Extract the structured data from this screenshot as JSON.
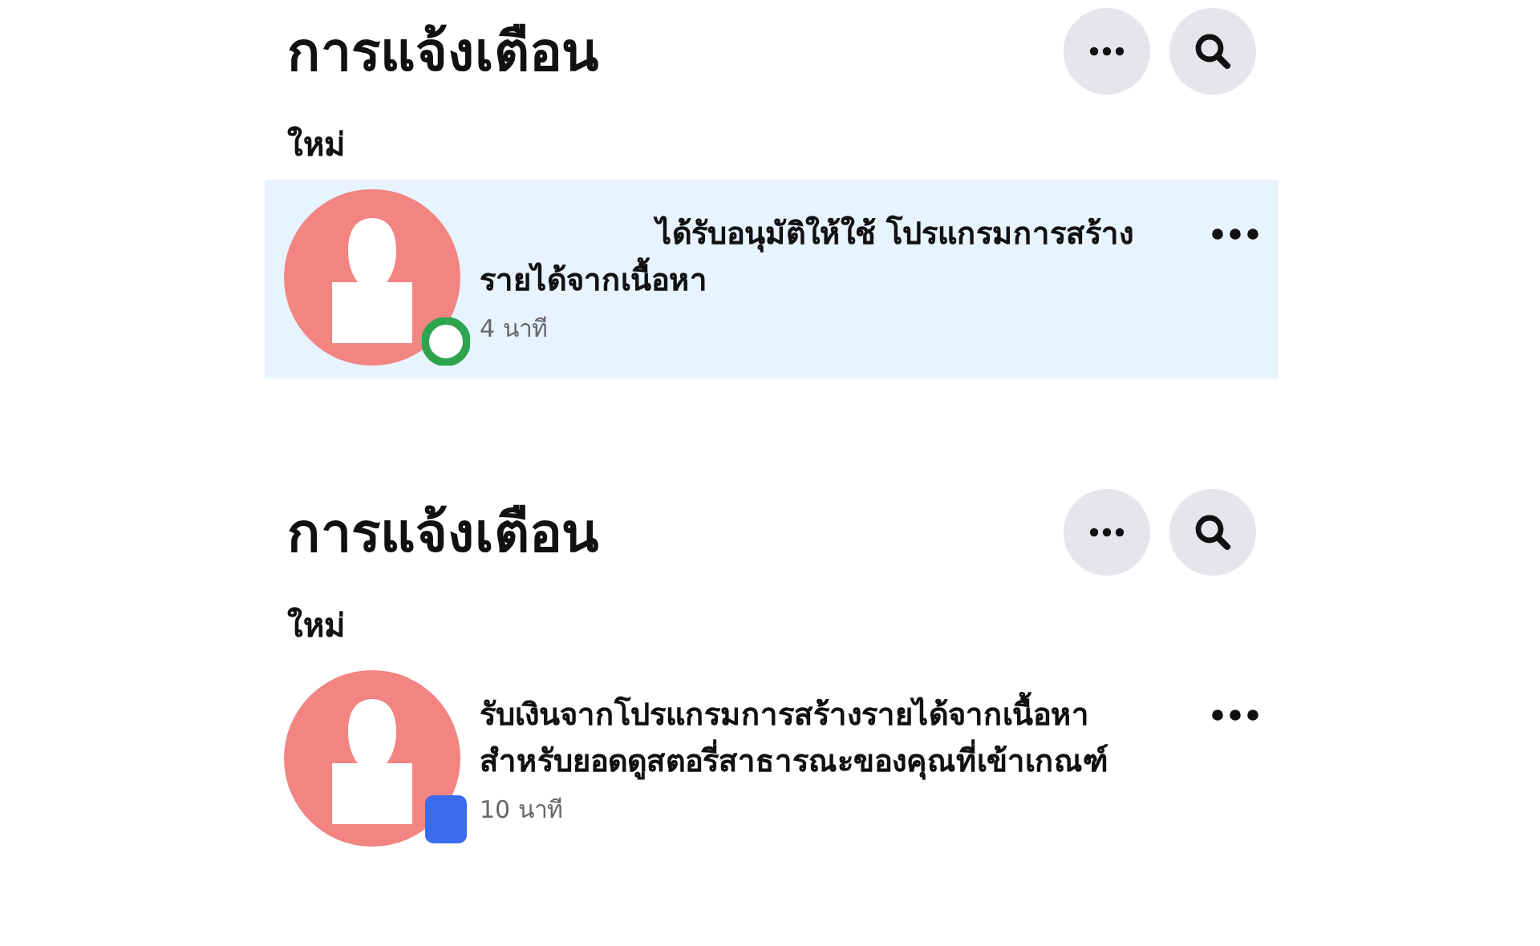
{
  "panels": [
    {
      "title": "การแจ้งเตือน",
      "section": "ใหม่",
      "notifications": [
        {
          "text": "ได้รับอนุมัติให้ใช้ โปรแกรมการสร้างรายได้จากเนื้อหา",
          "time": "4 นาที",
          "unread": true,
          "name_hidden": true,
          "badge": {
            "kind": "circle",
            "color": "#2ea44f"
          }
        }
      ]
    },
    {
      "title": "การแจ้งเตือน",
      "section": "ใหม่",
      "notifications": [
        {
          "text": "รับเงินจากโปรแกรมการสร้างรายได้จากเนื้อหาสำหรับยอดดูสตอรี่สาธารณะของคุณที่เข้าเกณฑ์",
          "time": "10 นาที",
          "unread": false,
          "name_hidden": false,
          "badge": {
            "kind": "square",
            "color": "#3b6cf0"
          }
        }
      ]
    }
  ]
}
